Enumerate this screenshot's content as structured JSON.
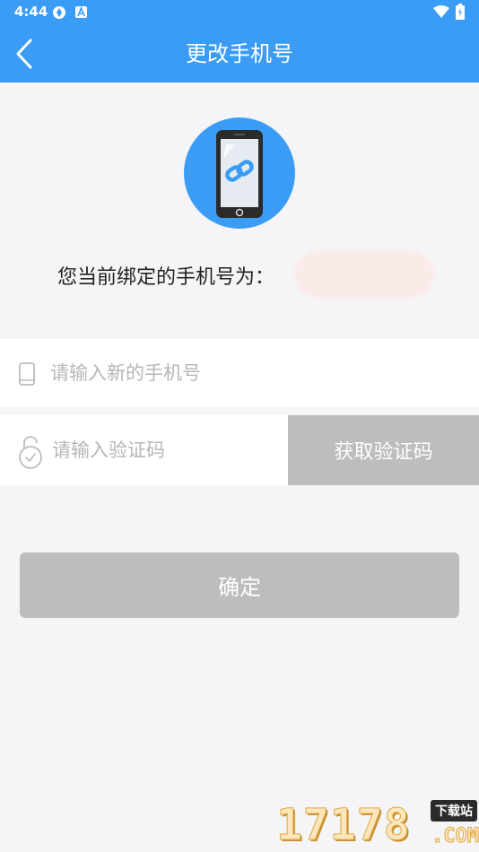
{
  "status_bar": {
    "time": "4:44",
    "icons": [
      "sync-status-icon",
      "a-status-icon",
      "wifi-icon",
      "battery-icon"
    ]
  },
  "header": {
    "title": "更改手机号",
    "back_icon": "chevron-left-icon",
    "background": "#3b9cf6"
  },
  "badge": {
    "icon": "phone-link-icon",
    "color": "#3b9cf6"
  },
  "current": {
    "label": "您当前绑定的手机号为："
  },
  "new_phone": {
    "placeholder": "请输入新的手机号",
    "value": "",
    "icon": "mobile-phone-icon"
  },
  "code": {
    "placeholder": "请输入验证码",
    "value": "",
    "icon": "lock-icon",
    "button_label": "获取验证码"
  },
  "confirm": {
    "label": "确定",
    "color": "#bdbdbd"
  },
  "watermark": {
    "digits": "17178",
    "tag": "下载站",
    "domain": ".COM"
  }
}
